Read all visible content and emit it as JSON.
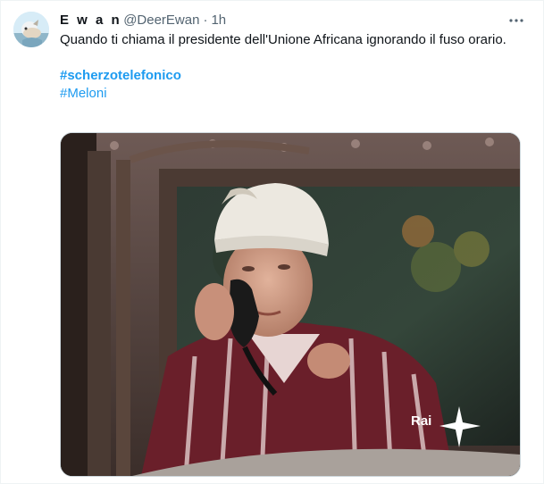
{
  "tweet": {
    "display_name": "E w a n",
    "handle": "@DeerEwan",
    "separator": "·",
    "time": "1h",
    "text": "Quando ti chiama il presidente dell'Unione Africana ignorando il fuso orario.",
    "hashtags": [
      "#scherzotelefonico",
      "#Meloni"
    ]
  },
  "media": {
    "watermark": "Rai"
  },
  "colors": {
    "link": "#1d9bf0",
    "secondary_text": "#536471"
  },
  "icons": {
    "more": "more-horizontal-icon"
  }
}
